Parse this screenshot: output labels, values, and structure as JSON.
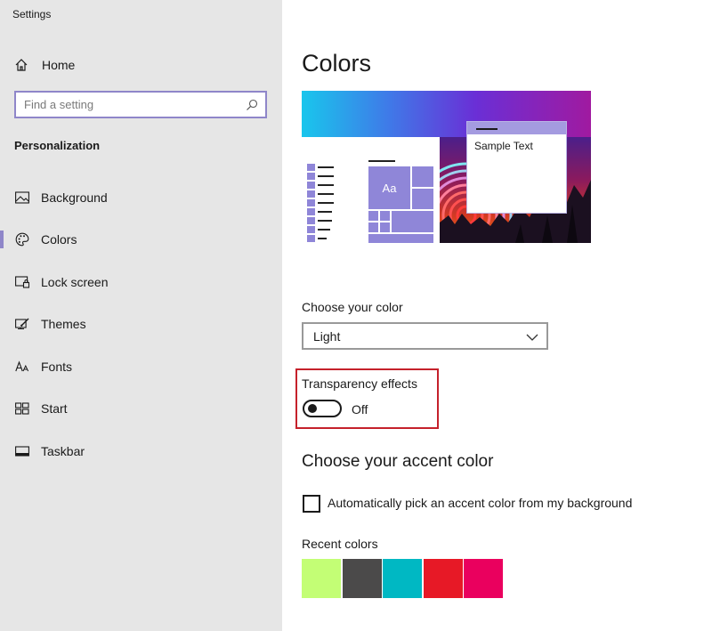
{
  "app": {
    "title": "Settings"
  },
  "sidebar": {
    "home_label": "Home",
    "search": {
      "placeholder": "Find a setting",
      "value": ""
    },
    "section_title": "Personalization",
    "items": [
      {
        "label": "Background",
        "icon": "picture-icon",
        "selected": false
      },
      {
        "label": "Colors",
        "icon": "palette-icon",
        "selected": true
      },
      {
        "label": "Lock screen",
        "icon": "lock-screen-icon",
        "selected": false
      },
      {
        "label": "Themes",
        "icon": "themes-icon",
        "selected": false
      },
      {
        "label": "Fonts",
        "icon": "fonts-icon",
        "selected": false
      },
      {
        "label": "Start",
        "icon": "start-icon",
        "selected": false
      },
      {
        "label": "Taskbar",
        "icon": "taskbar-icon",
        "selected": false
      }
    ]
  },
  "main": {
    "title": "Colors",
    "preview": {
      "tile_label": "Aa",
      "sample_text": "Sample Text"
    },
    "choose_color": {
      "label": "Choose your color",
      "value": "Light"
    },
    "transparency": {
      "label": "Transparency effects",
      "state": "Off",
      "on": false
    },
    "accent": {
      "title": "Choose your accent color",
      "auto_pick_label": "Automatically pick an accent color from my background",
      "auto_pick_checked": false,
      "recent_label": "Recent colors",
      "recent_colors": [
        "#c3fe75",
        "#4b4a4a",
        "#00b8c3",
        "#e71926",
        "#ea005e"
      ]
    }
  },
  "colors": {
    "accent": "#8f86c9",
    "highlight": "#c5212b",
    "sidebar_bg": "#e6e6e6"
  }
}
